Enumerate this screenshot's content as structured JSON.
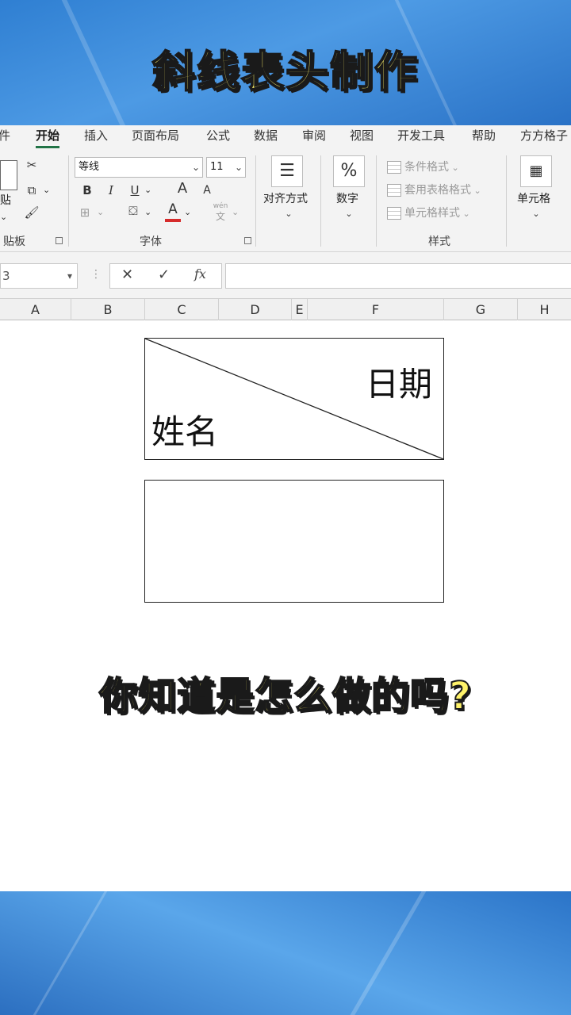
{
  "banner": {
    "title": "斜线表头制作"
  },
  "ribbon": {
    "tabs": [
      "件",
      "开始",
      "插入",
      "页面布局",
      "公式",
      "数据",
      "审阅",
      "视图",
      "开发工具",
      "帮助",
      "方方格子"
    ],
    "clipboard": {
      "paste_label": "贴",
      "group_label": "贴板"
    },
    "font": {
      "font_name": "等线",
      "font_size": "11",
      "bold": "B",
      "italic": "I",
      "underline": "U",
      "grow": "A",
      "shrink": "A",
      "font_color_letter": "A",
      "phonetic_top": "wén",
      "phonetic_bottom": "文",
      "group_label": "字体"
    },
    "alignment": {
      "label": "对齐方式"
    },
    "number": {
      "icon_text": "%",
      "label": "数字"
    },
    "styles": {
      "conditional": "条件格式",
      "table": "套用表格格式",
      "cell_styles": "单元格样式",
      "group_label": "样式"
    },
    "cells": {
      "label": "单元格"
    },
    "colors": {
      "accent": "#217346",
      "font_color_bar": "#d62b2b"
    }
  },
  "formula_bar": {
    "name_box": "3",
    "cancel": "✕",
    "enter": "✓",
    "fx": "fx",
    "value": ""
  },
  "columns": [
    "A",
    "B",
    "C",
    "D",
    "E",
    "F",
    "G",
    "H"
  ],
  "sheet": {
    "header_cell": {
      "top_right": "日期",
      "bottom_left": "姓名"
    },
    "empty_cell": ""
  },
  "caption": {
    "question": "你知道是怎么做的吗?"
  }
}
